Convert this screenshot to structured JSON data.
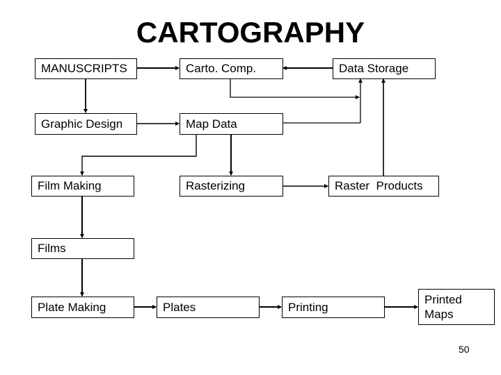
{
  "title": "CARTOGRAPHY",
  "nodes": {
    "manuscripts": "MANUSCRIPTS",
    "carto_comp": "Carto. Comp.",
    "data_storage": "Data Storage",
    "graphic_design": "Graphic Design",
    "map_data": "Map Data",
    "film_making": "Film Making",
    "rasterizing": "Rasterizing",
    "raster_products": "Raster  Products",
    "films": "Films",
    "plate_making": "Plate Making",
    "plates": "Plates",
    "printing": "Printing",
    "printed_maps": "Printed\nMaps"
  },
  "edges": [
    {
      "from": "MANUSCRIPTS",
      "to": "Carto. Comp."
    },
    {
      "from": "Data Storage",
      "to": "Carto. Comp."
    },
    {
      "from": "MANUSCRIPTS",
      "to": "Graphic Design"
    },
    {
      "from": "Carto. Comp.",
      "to": "Data Storage"
    },
    {
      "from": "Graphic Design",
      "to": "Map Data"
    },
    {
      "from": "Map Data",
      "to": "Data Storage"
    },
    {
      "from": "Map Data",
      "to": "Film Making"
    },
    {
      "from": "Map Data",
      "to": "Rasterizing"
    },
    {
      "from": "Rasterizing",
      "to": "Raster Products"
    },
    {
      "from": "Raster Products",
      "to": "Data Storage"
    },
    {
      "from": "Film Making",
      "to": "Films"
    },
    {
      "from": "Films",
      "to": "Plate Making"
    },
    {
      "from": "Plate Making",
      "to": "Plates"
    },
    {
      "from": "Plates",
      "to": "Printing"
    },
    {
      "from": "Printing",
      "to": "Printed Maps"
    }
  ],
  "page_number": "50"
}
